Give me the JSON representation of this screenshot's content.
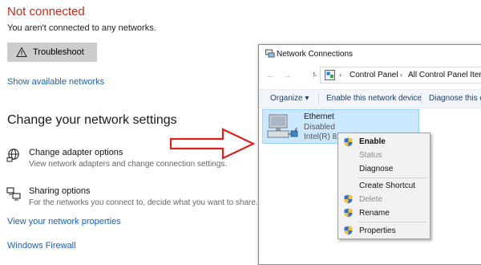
{
  "settings": {
    "status_title": "Not connected",
    "status_description": "You aren't connected to any networks.",
    "troubleshoot_label": "Troubleshoot",
    "show_networks_link": "Show available networks",
    "section_heading": "Change your network settings",
    "options": [
      {
        "title": "Change adapter options",
        "description": "View network adapters and change connection settings.",
        "icon": "network-adapter-icon"
      },
      {
        "title": "Sharing options",
        "description": "For the networks you connect to, decide what you want to share.",
        "icon": "sharing-icon"
      }
    ],
    "network_properties_link": "View your network properties",
    "firewall_link": "Windows Firewall"
  },
  "network_connections": {
    "window_title": "Network Connections",
    "breadcrumbs": [
      "Control Panel",
      "All Control Panel Items"
    ],
    "commands": [
      "Organize ▾",
      "Enable this network device",
      "Diagnose this c"
    ],
    "adapter": {
      "name": "Ethernet",
      "status": "Disabled",
      "device": "Intel(R) 825"
    }
  },
  "context_menu": {
    "items": [
      {
        "label": "Enable",
        "bold": true,
        "disabled": false,
        "shield": true
      },
      {
        "label": "Status",
        "bold": false,
        "disabled": true,
        "shield": false
      },
      {
        "label": "Diagnose",
        "bold": false,
        "disabled": false,
        "shield": false
      },
      {
        "label": "Create Shortcut",
        "bold": false,
        "disabled": false,
        "shield": false
      },
      {
        "label": "Delete",
        "bold": false,
        "disabled": true,
        "shield": true
      },
      {
        "label": "Rename",
        "bold": false,
        "disabled": false,
        "shield": true
      },
      {
        "label": "Properties",
        "bold": false,
        "disabled": false,
        "shield": true
      }
    ]
  },
  "colors": {
    "status_red": "#c42b1c",
    "link_blue": "#1a5fb4",
    "arrow_red": "#e0201b",
    "selection_blue": "#cce8ff"
  }
}
